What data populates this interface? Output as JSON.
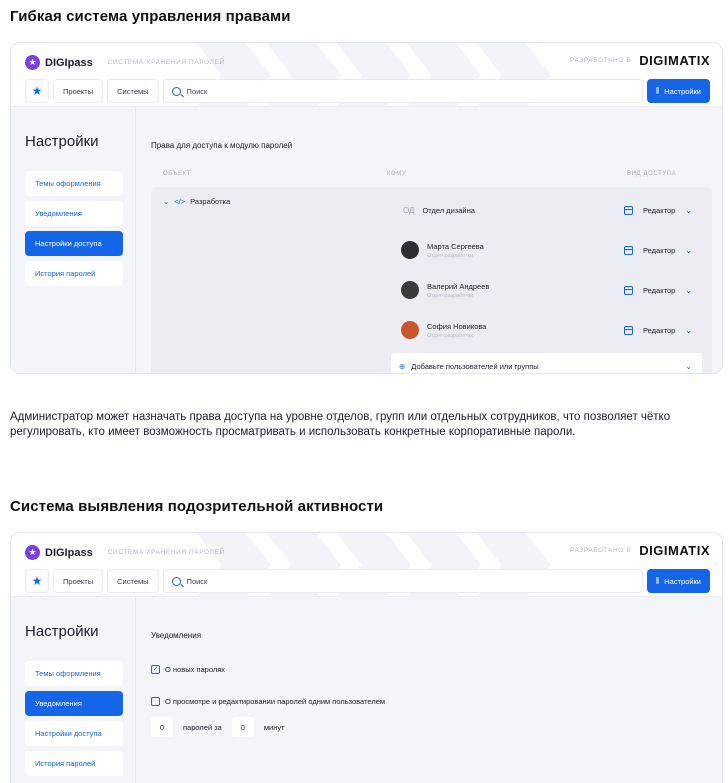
{
  "section1": {
    "title": "Гибкая система управления правами",
    "app": {
      "logo_name": "DIGIpass",
      "logo_sub": "СИСТЕМА ХРАНЕНИЯ ПАРОЛЕЙ",
      "developed_by": "РАЗРАБОТАНО В",
      "brand": "DIGIMATIX",
      "nav": {
        "projects": "Проекты",
        "systems": "Системы",
        "search": "Поиск",
        "settings": "Настройки"
      },
      "sidebar": {
        "title": "Настройки",
        "items": [
          "Темы оформления",
          "Уведомления",
          "Настройки доступа",
          "История паролей"
        ],
        "active_index": 2
      },
      "content": {
        "title": "Права для доступа к модулю паролей",
        "columns": [
          "ОБЪЕКТ",
          "КОМУ",
          "ВИД ДОСТУПА"
        ],
        "object": "Разработка",
        "object_code": "</>",
        "rows": [
          {
            "initials": "ОД",
            "name": "Отдел дизайна",
            "sub": "",
            "access": "Редактор"
          },
          {
            "name": "Марта Сергеева",
            "sub": "Отдел разработки",
            "access": "Редактор",
            "avatar_color": "#2e2e2e"
          },
          {
            "name": "Валерий Андреев",
            "sub": "Отдел разработки",
            "access": "Редактор",
            "avatar_color": "#3a3a3a"
          },
          {
            "name": "София Новикова",
            "sub": "Отдел разработки",
            "access": "Редактор",
            "avatar_color": "#c9552f"
          }
        ],
        "add_label": "Добавьте пользователей или группы"
      }
    }
  },
  "caption": "Администратор может назначать права доступа на уровне отделов, групп или отдельных сотрудников, что позволяет чётко регулировать, кто имеет возможность просматривать и использовать конкретные корпоративные пароли.",
  "section2": {
    "title": "Система выявления подозрительной активности",
    "app": {
      "logo_name": "DIGIpass",
      "logo_sub": "СИСТЕМА ХРАНЕНИЯ ПАРОЛЕЙ",
      "developed_by": "РАЗРАБОТАНО В",
      "brand": "DIGIMATIX",
      "nav": {
        "projects": "Проекты",
        "systems": "Системы",
        "search": "Поиск",
        "settings": "Настройки"
      },
      "sidebar": {
        "title": "Настройки",
        "items": [
          "Темы оформления",
          "Уведомления",
          "Настройки доступа",
          "История паролей"
        ],
        "active_index": 1
      },
      "content": {
        "title": "Уведомления",
        "check1": "О новых паролях",
        "check2": "О просмотре и редактировании паролей одним пользователем",
        "count_value": "0",
        "count_label": "паролей за",
        "minutes_value": "0",
        "minutes_label": "минут"
      }
    }
  },
  "colors": {
    "accent": "#1565e8",
    "logo": "#7b3fe4"
  }
}
